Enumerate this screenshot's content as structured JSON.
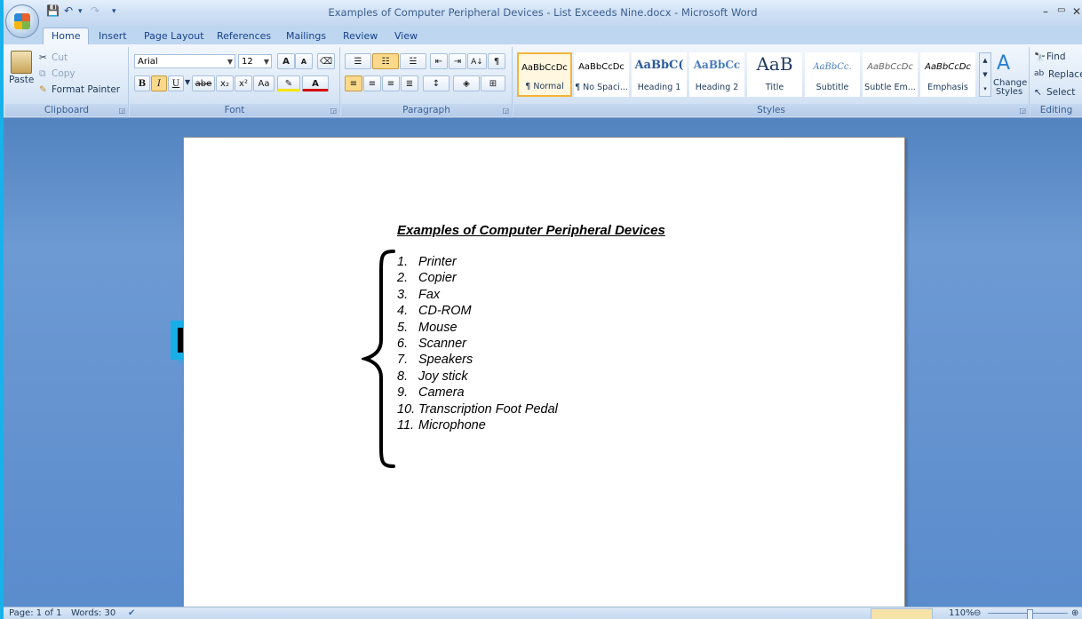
{
  "window": {
    "title": "Examples of Computer Peripheral Devices - List Exceeds Nine.docx - Microsoft Word",
    "controls": {
      "minimize": "–",
      "restore": "▭",
      "close": "✕"
    }
  },
  "quick_access": {
    "save": "💾",
    "undo": "↶",
    "redo": "↷",
    "more": "▾"
  },
  "tabs": [
    "Home",
    "Insert",
    "Page Layout",
    "References",
    "Mailings",
    "Review",
    "View"
  ],
  "ribbon": {
    "clipboard": {
      "label": "Clipboard",
      "paste": "Paste",
      "cut": "Cut",
      "copy": "Copy",
      "format_painter": "Format Painter"
    },
    "font": {
      "label": "Font",
      "font_name": "Arial",
      "font_size": "12",
      "bold": "B",
      "italic": "I",
      "underline": "U",
      "strike": "abe",
      "subscript": "x₂",
      "superscript": "x²",
      "change_case": "Aa",
      "grow": "A",
      "shrink": "A"
    },
    "paragraph": {
      "label": "Paragraph",
      "sort": "A↓",
      "pilcrow": "¶"
    },
    "styles": {
      "label": "Styles",
      "items": [
        {
          "preview": "AaBbCcDc",
          "name": "¶ Normal"
        },
        {
          "preview": "AaBbCcDc",
          "name": "¶ No Spaci..."
        },
        {
          "preview": "AaBbC(",
          "name": "Heading 1"
        },
        {
          "preview": "AaBbCc",
          "name": "Heading 2"
        },
        {
          "preview": "AaB",
          "name": "Title"
        },
        {
          "preview": "AaBbCc.",
          "name": "Subtitle"
        },
        {
          "preview": "AaBbCcDc",
          "name": "Subtle Em..."
        },
        {
          "preview": "AaBbCcDc",
          "name": "Emphasis"
        }
      ],
      "change_styles": "Change Styles"
    },
    "editing": {
      "label": "Editing",
      "find": "Find",
      "replace": "Replace",
      "select": "Select"
    }
  },
  "document": {
    "title": "Examples of Computer Peripheral Devices",
    "items": [
      {
        "num": "1.",
        "text": "Printer"
      },
      {
        "num": "2.",
        "text": "Copier"
      },
      {
        "num": "3.",
        "text": "Fax"
      },
      {
        "num": "4.",
        "text": "CD-ROM"
      },
      {
        "num": "5.",
        "text": "Mouse"
      },
      {
        "num": "6.",
        "text": "Scanner"
      },
      {
        "num": "7.",
        "text": "Speakers"
      },
      {
        "num": "8.",
        "text": "Joy stick"
      },
      {
        "num": "9.",
        "text": "Camera"
      },
      {
        "num": "10.",
        "text": "Transcription Foot Pedal"
      },
      {
        "num": "11.",
        "text": "Microphone"
      }
    ]
  },
  "status": {
    "page": "Page: 1 of 1",
    "words": "Words: 30",
    "zoom": "110%"
  },
  "colors": {
    "arrow_fill": "#000000",
    "arrow_outline": "#18aee8",
    "frame": "#17b2ec"
  }
}
